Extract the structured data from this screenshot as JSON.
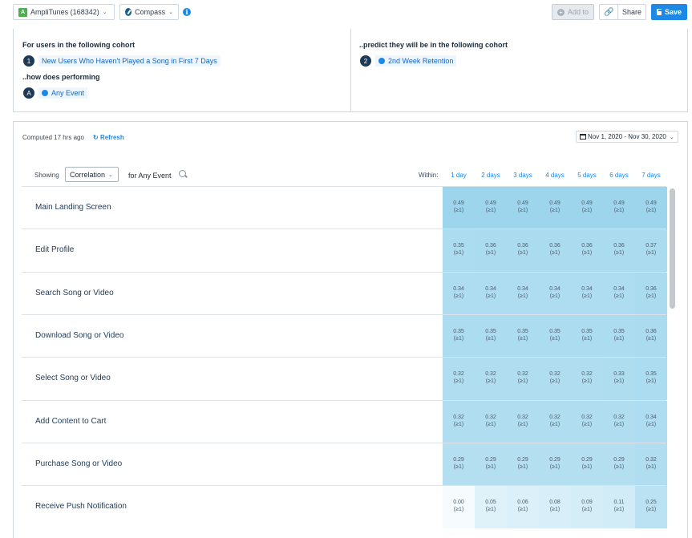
{
  "toolbar": {
    "app_badge": "A",
    "app_name": "AmpliTunes (168342)",
    "mode_label": "Compass",
    "add_to_label": "Add to",
    "share_label": "Share",
    "save_label": "Save"
  },
  "cohort": {
    "left_heading": "For users in the following cohort",
    "left_step": "1",
    "left_cohort": "New Users Who Haven't Played a Song in First 7 Days",
    "perform_heading": "..how does performing",
    "perform_step": "A",
    "perform_event": "Any Event",
    "right_heading": "..predict they will be in the following cohort",
    "right_step": "2",
    "right_cohort": "2nd Week Retention"
  },
  "results": {
    "computed": "Computed 17 hrs ago",
    "refresh": "Refresh",
    "date_range": "Nov 1, 2020 - Nov 30, 2020",
    "showing": "Showing",
    "metric": "Correlation",
    "for_event": "for Any Event",
    "within": "Within:",
    "days": [
      "1 day",
      "2 days",
      "3 days",
      "4 days",
      "5 days",
      "6 days",
      "7 days"
    ]
  },
  "rows": [
    {
      "label": "Main Landing Screen",
      "values": [
        "0.49",
        "0.49",
        "0.49",
        "0.49",
        "0.49",
        "0.49",
        "0.49"
      ],
      "sub": "(≥1)"
    },
    {
      "label": "Edit Profile",
      "values": [
        "0.35",
        "0.36",
        "0.36",
        "0.36",
        "0.36",
        "0.36",
        "0.37"
      ],
      "sub": "(≥1)"
    },
    {
      "label": "Search Song or Video",
      "values": [
        "0.34",
        "0.34",
        "0.34",
        "0.34",
        "0.34",
        "0.34",
        "0.36"
      ],
      "sub": "(≥1)"
    },
    {
      "label": "Download Song or Video",
      "values": [
        "0.35",
        "0.35",
        "0.35",
        "0.35",
        "0.35",
        "0.35",
        "0.36"
      ],
      "sub": "(≥1)"
    },
    {
      "label": "Select Song or Video",
      "values": [
        "0.32",
        "0.32",
        "0.32",
        "0.32",
        "0.32",
        "0.33",
        "0.35"
      ],
      "sub": "(≥1)"
    },
    {
      "label": "Add Content to Cart",
      "values": [
        "0.32",
        "0.32",
        "0.32",
        "0.32",
        "0.32",
        "0.32",
        "0.34"
      ],
      "sub": "(≥1)"
    },
    {
      "label": "Purchase Song or Video",
      "values": [
        "0.29",
        "0.29",
        "0.29",
        "0.29",
        "0.29",
        "0.29",
        "0.32"
      ],
      "sub": "(≥1)"
    },
    {
      "label": "Receive Push Notification",
      "values": [
        "0.00",
        "0.05",
        "0.06",
        "0.08",
        "0.09",
        "0.11",
        "0.25"
      ],
      "sub": "(≥1)"
    }
  ]
}
